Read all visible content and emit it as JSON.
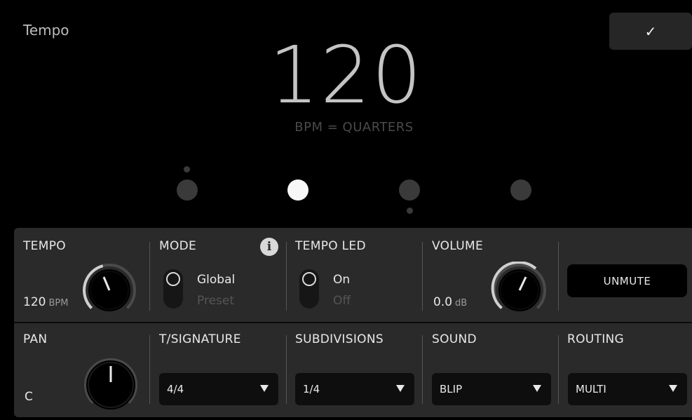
{
  "header": {
    "title": "Tempo",
    "confirm_glyph": "✓"
  },
  "display": {
    "bpm": "120",
    "subtitle": "BPM = QUARTERS",
    "beats": 4,
    "active_beat": 2
  },
  "row1": {
    "tempo": {
      "label": "TEMPO",
      "value": "120",
      "unit": "BPM"
    },
    "mode": {
      "label": "MODE",
      "info_glyph": "i",
      "option_on": "Global",
      "option_off": "Preset"
    },
    "tempo_led": {
      "label": "TEMPO LED",
      "option_on": "On",
      "option_off": "Off"
    },
    "volume": {
      "label": "VOLUME",
      "value": "0.0",
      "unit": "dB"
    },
    "unmute": {
      "label": "UNMUTE"
    }
  },
  "row2": {
    "pan": {
      "label": "PAN",
      "value": "C"
    },
    "tsig": {
      "label": "T/SIGNATURE",
      "value": "4/4"
    },
    "subdiv": {
      "label": "SUBDIVISIONS",
      "value": "1/4"
    },
    "sound": {
      "label": "SOUND",
      "value": "BLIP"
    },
    "routing": {
      "label": "ROUTING",
      "value": "MULTI"
    }
  },
  "colors": {
    "background": "#000000",
    "panel": "#2a2a2a",
    "active_beat": "#f7f7f7",
    "inactive_beat": "#3a3a3a"
  }
}
